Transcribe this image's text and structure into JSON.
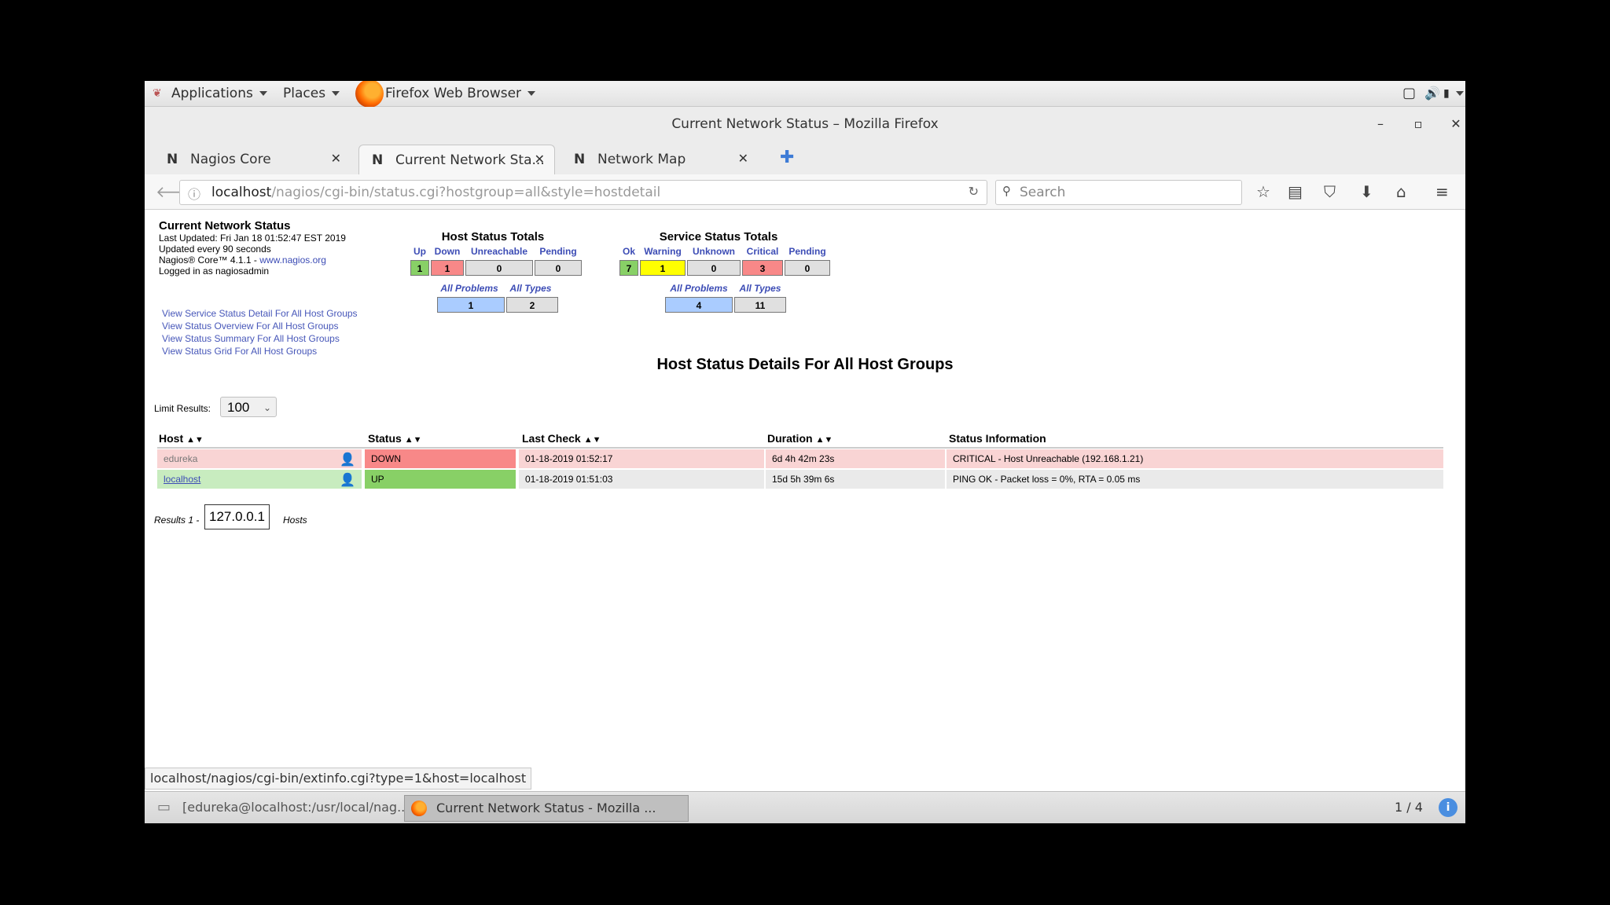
{
  "panel": {
    "applications": "Applications",
    "places": "Places",
    "browser": "Firefox Web Browser"
  },
  "window": {
    "title": "Current Network Status – Mozilla Firefox",
    "minimize": "–",
    "maximize": "▫",
    "close": "✕"
  },
  "tabs": [
    {
      "label": "Nagios Core",
      "favicon": "N"
    },
    {
      "label": "Current Network Sta...",
      "favicon": "N"
    },
    {
      "label": "Network Map",
      "favicon": "N"
    }
  ],
  "url": {
    "host": "localhost",
    "path": "/nagios/cgi-bin/status.cgi?hostgroup=all&style=hostdetail"
  },
  "search": {
    "placeholder": "Search"
  },
  "info": {
    "title": "Current Network Status",
    "last_updated": "Last Updated: Fri Jan 18 01:52:47 EST 2019",
    "update_interval": "Updated every 90 seconds",
    "version_prefix": "Nagios® Core™ 4.1.1 - ",
    "version_link": "www.nagios.org",
    "logged_in": "Logged in as nagiosadmin",
    "links": [
      "View Service Status Detail For All Host Groups",
      "View Status Overview For All Host Groups",
      "View Status Summary For All Host Groups",
      "View Status Grid For All Host Groups"
    ]
  },
  "host_totals": {
    "title": "Host Status Totals",
    "headers": [
      "Up",
      "Down",
      "Unreachable",
      "Pending"
    ],
    "values": [
      "1",
      "1",
      "0",
      "0"
    ],
    "sub_headers": [
      "All Problems",
      "All Types"
    ],
    "sub_values": [
      "1",
      "2"
    ]
  },
  "service_totals": {
    "title": "Service Status Totals",
    "headers": [
      "Ok",
      "Warning",
      "Unknown",
      "Critical",
      "Pending"
    ],
    "values": [
      "7",
      "1",
      "0",
      "3",
      "0"
    ],
    "sub_headers": [
      "All Problems",
      "All Types"
    ],
    "sub_values": [
      "4",
      "11"
    ]
  },
  "details": {
    "heading": "Host Status Details For All Host Groups",
    "limit_label": "Limit Results:",
    "limit_value": "100",
    "columns": [
      "Host",
      "Status",
      "Last Check",
      "Duration",
      "Status Information"
    ],
    "rows": [
      {
        "host": "edureka",
        "status": "DOWN",
        "last_check": "01-18-2019 01:52:17",
        "duration": "6d 4h 42m 23s",
        "info": "CRITICAL - Host Unreachable (192.168.1.21)"
      },
      {
        "host": "localhost",
        "status": "UP",
        "last_check": "01-18-2019 01:51:03",
        "duration": "15d 5h 39m 6s",
        "info": "PING OK - Packet loss = 0%, RTA = 0.05 ms"
      }
    ],
    "results_prefix": "Results 1 -",
    "tooltip": "127.0.0.1",
    "results_suffix": "Hosts"
  },
  "status_bar": {
    "url": "localhost/nagios/cgi-bin/extinfo.cgi?type=1&host=localhost"
  },
  "taskbar": {
    "items": [
      "[edureka@localhost:/usr/local/nag...",
      "Current Network Status - Mozilla ..."
    ],
    "workspace": "1 / 4"
  },
  "colors": {
    "up": "#88d066",
    "down": "#f88888",
    "warning": "#ffff00",
    "critical": "#f88888",
    "neutral": "#e0e0e0",
    "problems": "#aaccff",
    "row_down": "#f9d4d4",
    "row_up_host": "#c8ecbf",
    "row_even": "#eaeaea"
  }
}
